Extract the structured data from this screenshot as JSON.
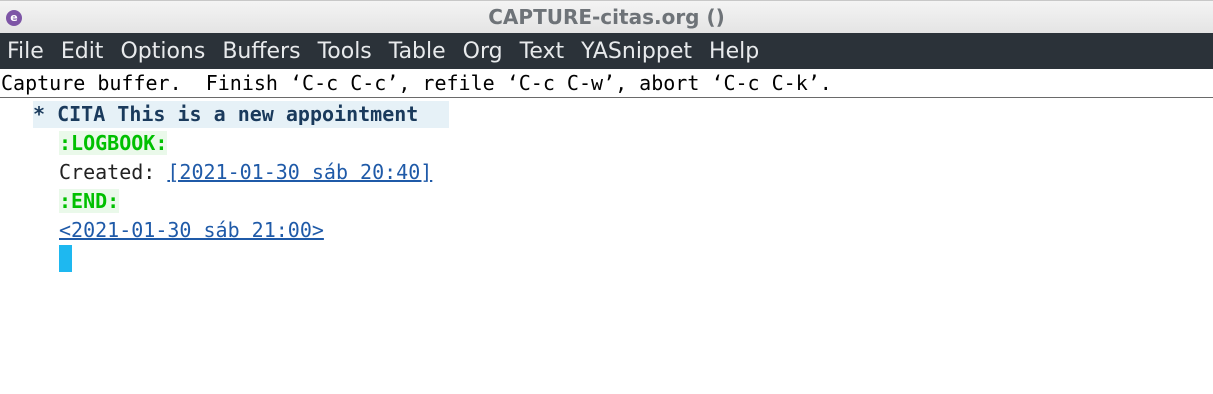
{
  "window": {
    "title": "CAPTURE-citas.org ()",
    "icon_letter": "e"
  },
  "menu": {
    "items": [
      "File",
      "Edit",
      "Options",
      "Buffers",
      "Tools",
      "Table",
      "Org",
      "Text",
      "YASnippet",
      "Help"
    ]
  },
  "header_line": {
    "text": "Capture buffer.  Finish ‘C-c C-c’, refile ‘C-c C-w’, abort ‘C-c C-k’."
  },
  "buffer": {
    "heading_star": "*",
    "heading_text": "CITA This is a new appointment",
    "logbook_start": ":LOGBOOK:",
    "created_label": "Created:",
    "created_timestamp": "[2021-01-30 sáb 20:40]",
    "logbook_end": ":END:",
    "scheduled_timestamp": "<2021-01-30 sáb 21:00>"
  },
  "colors": {
    "menubar_bg": "#2b3239",
    "heading_fg": "#1a3a5c",
    "drawer_fg": "#00c000",
    "timestamp_fg": "#1f5aa8",
    "cursor": "#1eb8f0"
  }
}
